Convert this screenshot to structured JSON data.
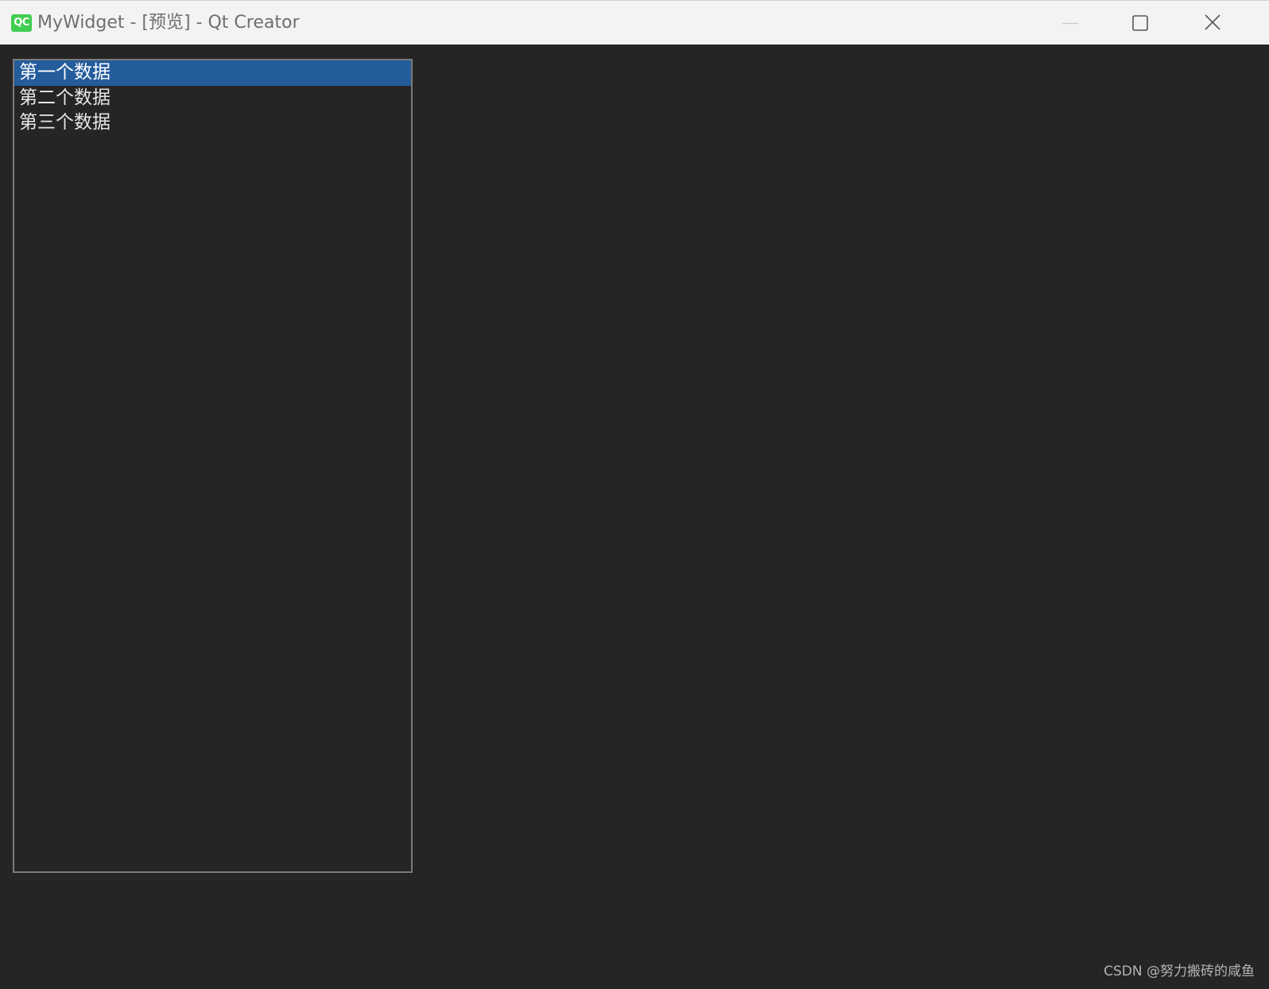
{
  "window": {
    "app_icon_text": "QC",
    "title": "MyWidget - [预览] - Qt Creator",
    "controls": {
      "minimize_icon": "minimize-icon",
      "maximize_icon": "maximize-icon",
      "close_icon": "close-icon"
    }
  },
  "list": {
    "items": [
      {
        "label": "第一个数据",
        "selected": true
      },
      {
        "label": "第二个数据",
        "selected": false
      },
      {
        "label": "第三个数据",
        "selected": false
      }
    ]
  },
  "watermark": "CSDN @努力搬砖的咸鱼",
  "colors": {
    "background": "#252526",
    "selection": "#245c9c",
    "titlebar": "#f3f3f3",
    "qt_green": "#41cd52"
  }
}
